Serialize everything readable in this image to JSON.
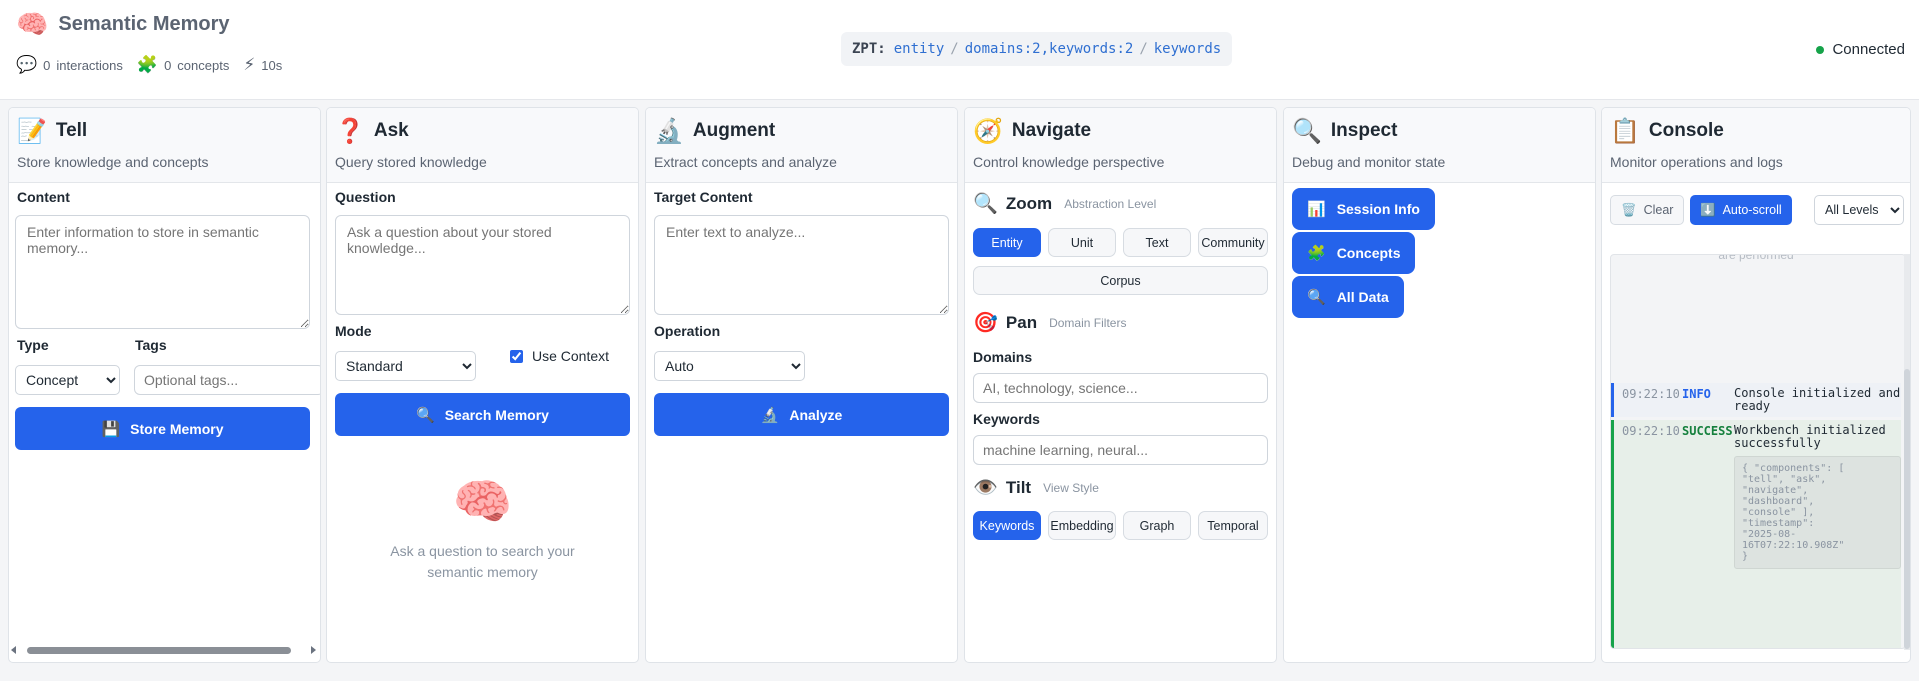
{
  "header": {
    "logo_icon": "brain-icon",
    "title": "Semantic Memory",
    "stats": {
      "interactions_count": "0",
      "interactions_label": "interactions",
      "concepts_count": "0",
      "concepts_label": "concepts",
      "time": "10s"
    },
    "zpt": {
      "label": "ZPT:",
      "zoom": "entity",
      "pan": "domains:2,keywords:2",
      "tilt": "keywords",
      "separator": "/"
    },
    "connection": {
      "status": "Connected",
      "color": "#16a34a"
    }
  },
  "tell": {
    "icon": "memo-icon",
    "title": "Tell",
    "subtitle": "Store knowledge and concepts",
    "content_label": "Content",
    "content_placeholder": "Enter information to store in semantic memory...",
    "type_label": "Type",
    "type_value": "Concept",
    "tags_label": "Tags",
    "tags_placeholder": "Optional tags...",
    "button": "Store Memory"
  },
  "ask": {
    "icon": "question-mark-icon",
    "title": "Ask",
    "subtitle": "Query stored knowledge",
    "question_label": "Question",
    "question_placeholder": "Ask a question about your stored knowledge...",
    "mode_label": "Mode",
    "mode_value": "Standard",
    "use_context_label": "Use Context",
    "use_context_checked": true,
    "button": "Search Memory",
    "empty_text": "Ask a question to search your semantic memory"
  },
  "augment": {
    "icon": "microscope-icon",
    "title": "Augment",
    "subtitle": "Extract concepts and analyze",
    "target_label": "Target Content",
    "target_placeholder": "Enter text to analyze...",
    "operation_label": "Operation",
    "operation_value": "Auto",
    "button": "Analyze"
  },
  "navigate": {
    "icon": "compass-icon",
    "title": "Navigate",
    "subtitle": "Control knowledge perspective",
    "zoom": {
      "title": "Zoom",
      "hint": "Abstraction Level",
      "options": [
        "Entity",
        "Unit",
        "Text",
        "Community",
        "Corpus"
      ],
      "active": "Entity"
    },
    "pan": {
      "title": "Pan",
      "hint": "Domain Filters",
      "domains_label": "Domains",
      "domains_placeholder": "AI, technology, science...",
      "keywords_label": "Keywords",
      "keywords_placeholder": "machine learning, neural..."
    },
    "tilt": {
      "title": "Tilt",
      "hint": "View Style",
      "options": [
        "Keywords",
        "Embedding",
        "Graph",
        "Temporal"
      ],
      "active": "Keywords"
    }
  },
  "inspect": {
    "icon": "magnifier-icon",
    "title": "Inspect",
    "subtitle": "Debug and monitor state",
    "buttons": [
      "Session Info",
      "Concepts",
      "All Data"
    ]
  },
  "console": {
    "icon": "clipboard-icon",
    "title": "Console",
    "subtitle": "Monitor operations and logs",
    "clear_label": "Clear",
    "autoscroll_label": "Auto-scroll",
    "level_value": "All Levels",
    "faded_text": "are performed",
    "entries": [
      {
        "time": "09:22:10",
        "level": "INFO",
        "message": "Console initialized and ready"
      },
      {
        "time": "09:22:10",
        "level": "SUCCESS",
        "message": "Workbench initialized successfully",
        "details": "{ \"components\": [\n\"tell\", \"ask\",\n\"navigate\",\n\"dashboard\",\n\"console\" ],\n\"timestamp\":\n\"2025-08-\n16T07:22:10.908Z\"\n}"
      }
    ]
  }
}
